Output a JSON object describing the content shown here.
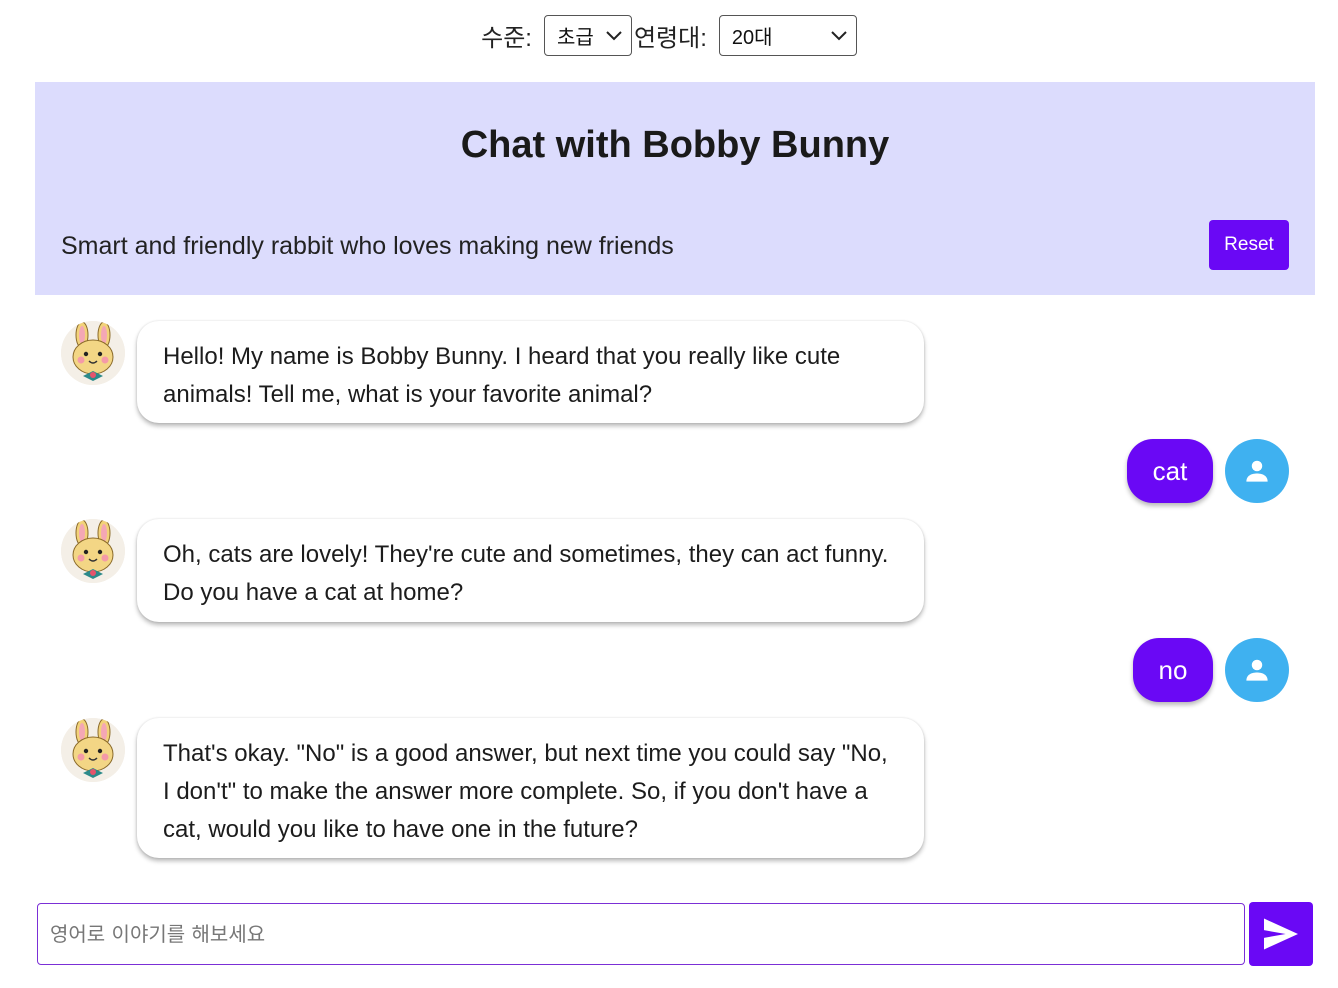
{
  "selectors": {
    "level_label": "수준:",
    "level_value": "초급",
    "age_label": "연령대:",
    "age_value": "20대"
  },
  "header": {
    "title": "Chat with Bobby Bunny",
    "subtitle": "Smart and friendly rabbit who loves making new friends",
    "reset_label": "Reset"
  },
  "messages": [
    {
      "role": "bot",
      "text": "Hello! My name is Bobby Bunny. I heard that you really like cute animals! Tell me, what is your favorite animal?"
    },
    {
      "role": "user",
      "text": "cat"
    },
    {
      "role": "bot",
      "text": "Oh, cats are lovely! They're cute and sometimes, they can act funny. Do you have a cat at home?"
    },
    {
      "role": "user",
      "text": "no"
    },
    {
      "role": "bot",
      "text": "That's okay. \"No\" is a good answer, but next time you could say \"No, I don't\" to make the answer more complete. So, if you don't have a cat, would you like to have one in the future?"
    }
  ],
  "input": {
    "placeholder": "영어로 이야기를 해보세요",
    "value": ""
  },
  "icons": {
    "bot_avatar": "bunny-avatar-icon",
    "user_avatar": "person-icon",
    "send": "send-icon",
    "dropdown": "chevron-down-icon"
  },
  "colors": {
    "accent": "#6a08f5",
    "header_bg": "#dcdcfd",
    "user_avatar_bg": "#3fb1f0"
  }
}
